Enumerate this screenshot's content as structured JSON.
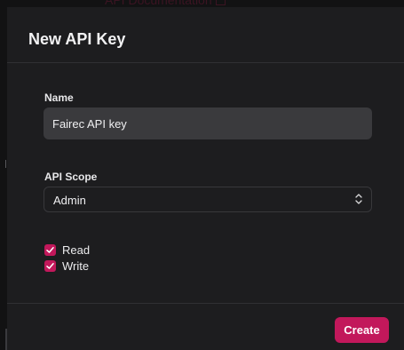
{
  "backdrop": {
    "link_text": "API Documentation"
  },
  "modal": {
    "title": "New API Key",
    "name_field": {
      "label": "Name",
      "value": "Fairec API key",
      "placeholder": ""
    },
    "scope_field": {
      "label": "API Scope",
      "selected": "Admin"
    },
    "permissions": [
      {
        "label": "Read",
        "checked": true
      },
      {
        "label": "Write",
        "checked": true
      }
    ],
    "create_label": "Create"
  },
  "colors": {
    "accent": "#c2185b",
    "modal_bg": "#1d1d1f",
    "input_bg": "#3a3a3d",
    "page_bg": "#121213"
  },
  "icons": {
    "select": "chevron-up-down-icon",
    "checkbox": "checkmark-icon",
    "external": "external-link-icon"
  }
}
